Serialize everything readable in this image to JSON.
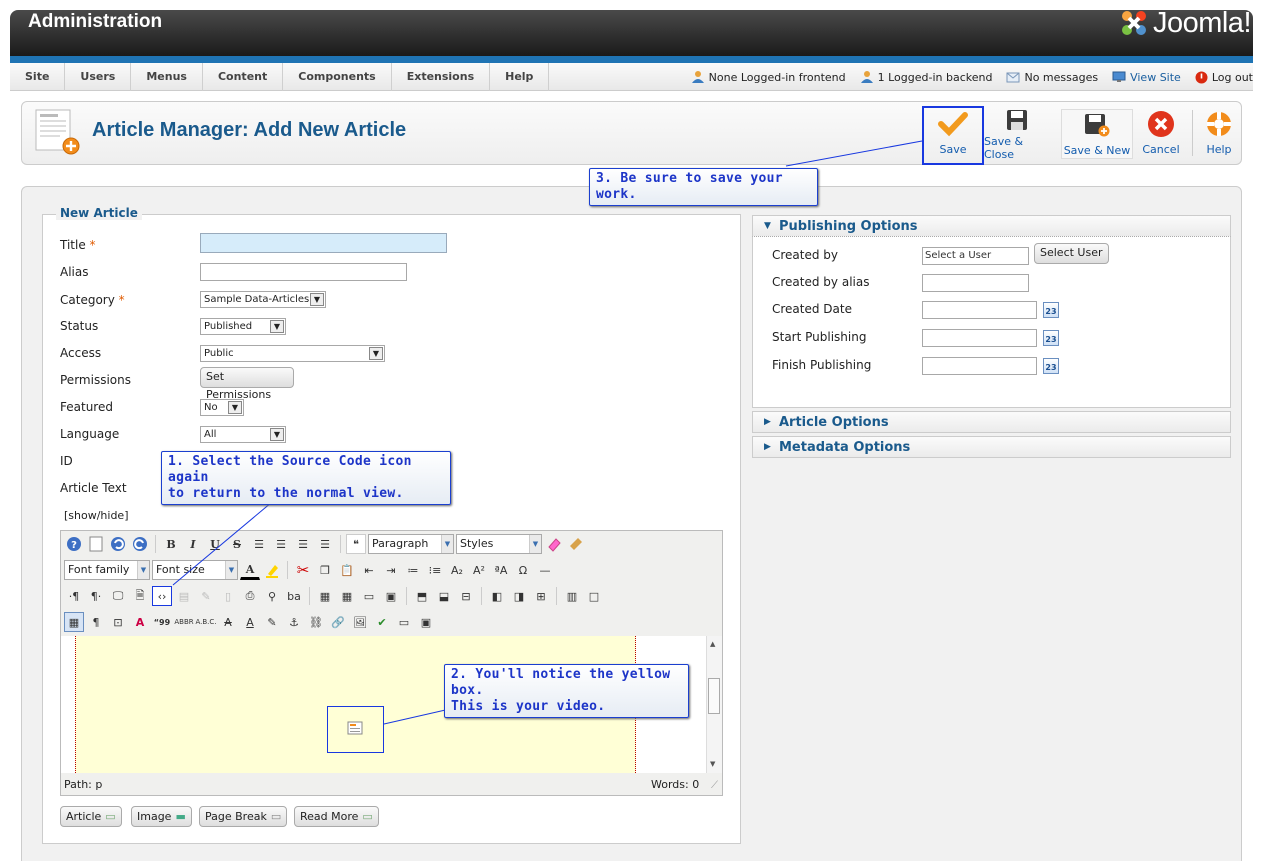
{
  "header": {
    "title": "Administration",
    "brand": "Joomla!"
  },
  "menu": [
    "Site",
    "Users",
    "Menus",
    "Content",
    "Components",
    "Extensions",
    "Help"
  ],
  "status": {
    "frontend": "None Logged-in frontend",
    "backend": "1 Logged-in backend",
    "messages": "No messages",
    "view_site": "View Site",
    "logout": "Log out"
  },
  "toolbar": {
    "title": "Article Manager: Add New Article",
    "save": "Save",
    "save_close": "Save & Close",
    "save_new": "Save & New",
    "cancel": "Cancel",
    "help": "Help"
  },
  "form": {
    "legend": "New Article",
    "title_label": "Title",
    "alias_label": "Alias",
    "category_label": "Category",
    "category_value": "Sample Data-Articles",
    "status_label": "Status",
    "status_value": "Published",
    "access_label": "Access",
    "access_value": "Public",
    "permissions_label": "Permissions",
    "permissions_button": "Set Permissions",
    "featured_label": "Featured",
    "featured_value": "No",
    "language_label": "Language",
    "language_value": "All",
    "id_label": "ID",
    "text_label": "Article Text",
    "required_mark": "*",
    "showhide": "[show/hide]"
  },
  "editor": {
    "paragraph": "Paragraph",
    "styles": "Styles",
    "font_family": "Font family",
    "font_size": "Font size",
    "path": "Path: p",
    "words": "Words: 0",
    "buttons": [
      "Article",
      "Image",
      "Page Break",
      "Read More"
    ]
  },
  "publishing": {
    "header": "Publishing Options",
    "created_by": "Created by",
    "select_user_placeholder": "Select a User",
    "select_user_button": "Select User",
    "created_by_alias": "Created by alias",
    "created_date": "Created Date",
    "start_publishing": "Start Publishing",
    "finish_publishing": "Finish Publishing",
    "calendar_day": "23"
  },
  "panels": {
    "article_options": "Article Options",
    "metadata_options": "Metadata Options"
  },
  "callouts": {
    "c1_line1": "1. Select the Source Code icon again",
    "c1_line2": "to return to the normal view.",
    "c2_line1": "2. You'll notice the yellow box.",
    "c2_line2": "This is your video.",
    "c3": "3. Be sure to save your work."
  },
  "colors": {
    "accent": "#1f74b4",
    "title": "#1a5a8c",
    "callout": "#1d35c8",
    "editor_placeholder": "#ffffd6"
  }
}
